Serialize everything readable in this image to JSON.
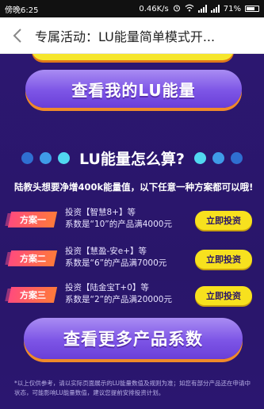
{
  "status_bar": {
    "time": "傍晚6:25",
    "network_speed": "0.46K/s",
    "battery": "71%"
  },
  "nav": {
    "title": "专属活动：LU能量简单模式开..."
  },
  "buttons": {
    "my_lu": "查看我的LU能量",
    "more_coefficients": "查看更多产品系数"
  },
  "section": {
    "heading": "LU能量怎么算?",
    "intro": "陆教头想要净增400k能量值，以下任意一种方案都可以哦!"
  },
  "plans": [
    {
      "tag": "方案一",
      "line1": "投资【智慧8+】等",
      "line2": "系数是“10”的产品满4000元",
      "action": "立即投资"
    },
    {
      "tag": "方案二",
      "line1": "投资【慧盈-安e+】等",
      "line2": "系数是“6”的产品满7000元",
      "action": "立即投资"
    },
    {
      "tag": "方案三",
      "line1": "投资【陆金宝T+0】等",
      "line2": "系数是“2”的产品满20000元",
      "action": "立即投资"
    }
  ],
  "footnote": "*以上仅供参考，请以实际页面展示的LU能量数值及规则为准；如您有部分产品还在申请中状态，可能影响LU能量数值，建议您提前安排投资计划。",
  "colors": {
    "background": "#2a1668",
    "accent_yellow": "#f7e11e",
    "button_purple": "#7d55e6",
    "tag_gradient_start": "#ff4b7d",
    "tag_gradient_end": "#ff7a3a"
  }
}
